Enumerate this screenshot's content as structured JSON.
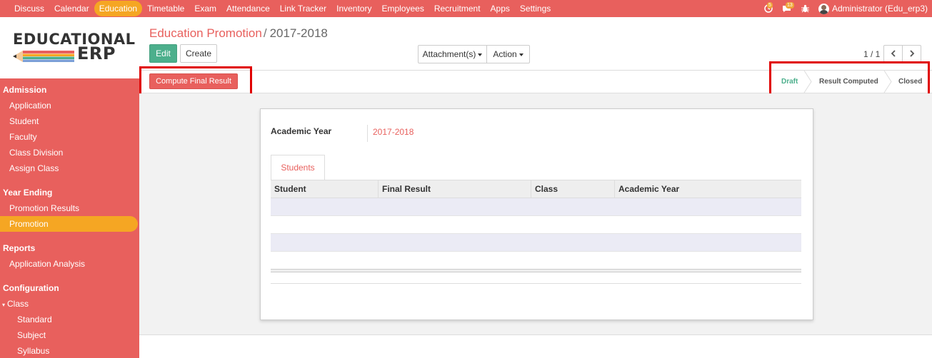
{
  "topbar": {
    "menu": [
      {
        "label": "Discuss",
        "active": false
      },
      {
        "label": "Calendar",
        "active": false
      },
      {
        "label": "Education",
        "active": true
      },
      {
        "label": "Timetable",
        "active": false
      },
      {
        "label": "Exam",
        "active": false
      },
      {
        "label": "Attendance",
        "active": false
      },
      {
        "label": "Link Tracker",
        "active": false
      },
      {
        "label": "Inventory",
        "active": false
      },
      {
        "label": "Employees",
        "active": false
      },
      {
        "label": "Recruitment",
        "active": false
      },
      {
        "label": "Apps",
        "active": false
      },
      {
        "label": "Settings",
        "active": false
      }
    ],
    "activity_count": "5",
    "message_count": "13",
    "user_label": "Administrator (Edu_erp3)"
  },
  "logo": {
    "line1": "EDUCATIONAL",
    "line2": "ERP"
  },
  "sidebar": {
    "sections": [
      {
        "title": "Admission",
        "items": [
          {
            "label": "Application"
          },
          {
            "label": "Student"
          },
          {
            "label": "Faculty"
          },
          {
            "label": "Class Division"
          },
          {
            "label": "Assign Class"
          }
        ]
      },
      {
        "title": "Year Ending",
        "items": [
          {
            "label": "Promotion Results"
          },
          {
            "label": "Promotion",
            "active": true
          }
        ]
      },
      {
        "title": "Reports",
        "items": [
          {
            "label": "Application Analysis"
          }
        ]
      },
      {
        "title": "Configuration",
        "items": [
          {
            "label": "Class",
            "expanded": true
          },
          {
            "label": "Standard",
            "sub": true
          },
          {
            "label": "Subject",
            "sub": true
          },
          {
            "label": "Syllabus",
            "sub": true
          }
        ]
      }
    ]
  },
  "breadcrumb": {
    "parent": "Education Promotion",
    "separator": "/",
    "current": "2017-2018"
  },
  "buttons": {
    "edit": "Edit",
    "create": "Create",
    "attachments": "Attachment(s)",
    "action": "Action",
    "compute": "Compute Final Result"
  },
  "pager": {
    "value": "1 / 1"
  },
  "stages": {
    "draft": "Draft",
    "computed": "Result Computed",
    "closed": "Closed",
    "current": "Draft"
  },
  "form": {
    "academic_year_label": "Academic Year",
    "academic_year_value": "2017-2018",
    "tab_students": "Students",
    "columns": [
      "Student",
      "Final Result",
      "Class",
      "Academic Year"
    ]
  },
  "colors": {
    "brand": "#e8605d",
    "accent": "#f5a623",
    "primary_button": "#4caf8c",
    "highlight": "#e00000"
  }
}
